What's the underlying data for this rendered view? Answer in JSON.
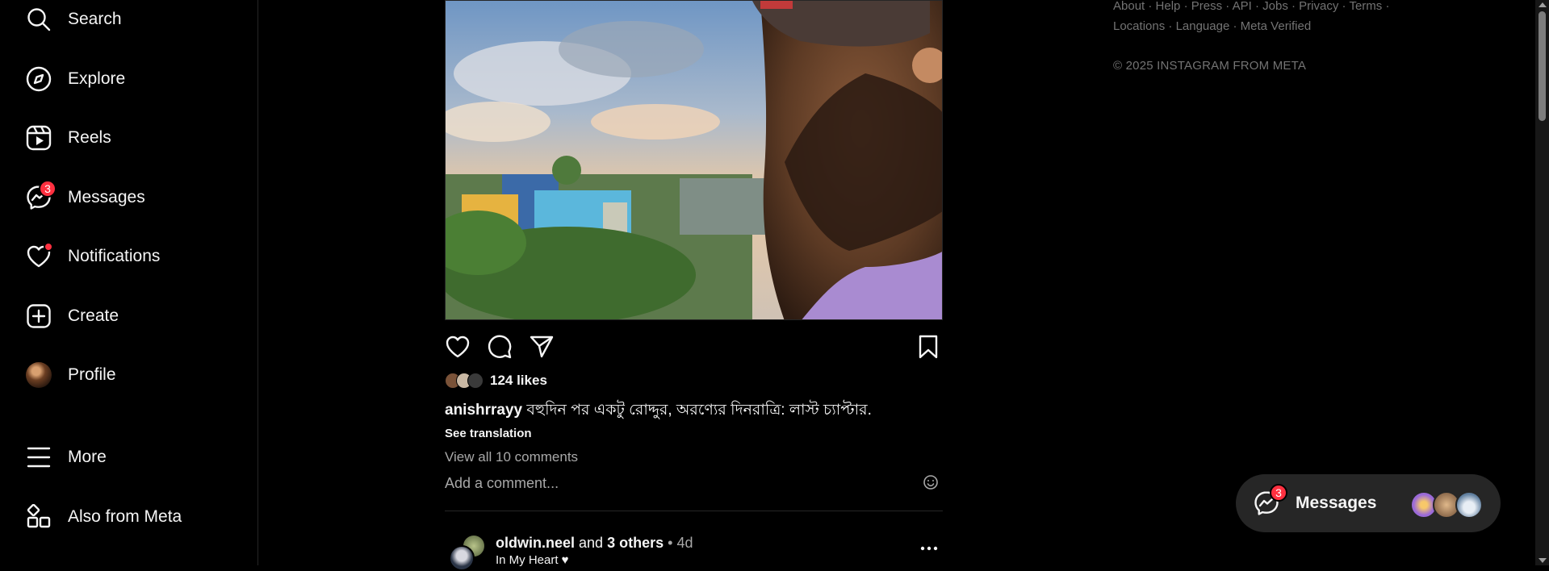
{
  "sidebar": {
    "items": [
      {
        "label": "Search",
        "icon": "search-icon"
      },
      {
        "label": "Explore",
        "icon": "compass-icon"
      },
      {
        "label": "Reels",
        "icon": "reels-icon"
      },
      {
        "label": "Messages",
        "icon": "messenger-icon",
        "badge": "3"
      },
      {
        "label": "Notifications",
        "icon": "heart-icon",
        "dot": true
      },
      {
        "label": "Create",
        "icon": "plus-square-icon"
      },
      {
        "label": "Profile",
        "icon": "profile-avatar"
      },
      {
        "label": "More",
        "icon": "menu-icon"
      },
      {
        "label": "Also from Meta",
        "icon": "meta-apps-icon"
      }
    ]
  },
  "post": {
    "likes_text": "124 likes",
    "caption_user": "anishrrayy",
    "caption_text": "বহুদিন পর একটু রোদ্দুর, অরণ্যের দিনরাত্রি: লাস্ট চ্যাপ্টার.",
    "see_translation": "See translation",
    "view_comments": "View all 10 comments",
    "add_comment_placeholder": "Add a comment..."
  },
  "next_post": {
    "username": "oldwin.neel",
    "and_text": "and",
    "others": "3 others",
    "separator": "•",
    "time": "4d",
    "location": "In My Heart ♥"
  },
  "footer": {
    "links_row1": [
      "About",
      "Help",
      "Press",
      "API",
      "Jobs",
      "Privacy",
      "Terms"
    ],
    "links_row2": [
      "Locations",
      "Language",
      "Meta Verified"
    ],
    "separator": "·",
    "copyright": "© 2025 INSTAGRAM FROM META"
  },
  "messages_pill": {
    "label": "Messages",
    "badge": "3"
  },
  "colors": {
    "background": "#000000",
    "text": "#f5f5f5",
    "muted": "#a8a8a8",
    "badge": "#ff3040",
    "pill": "#262626"
  }
}
